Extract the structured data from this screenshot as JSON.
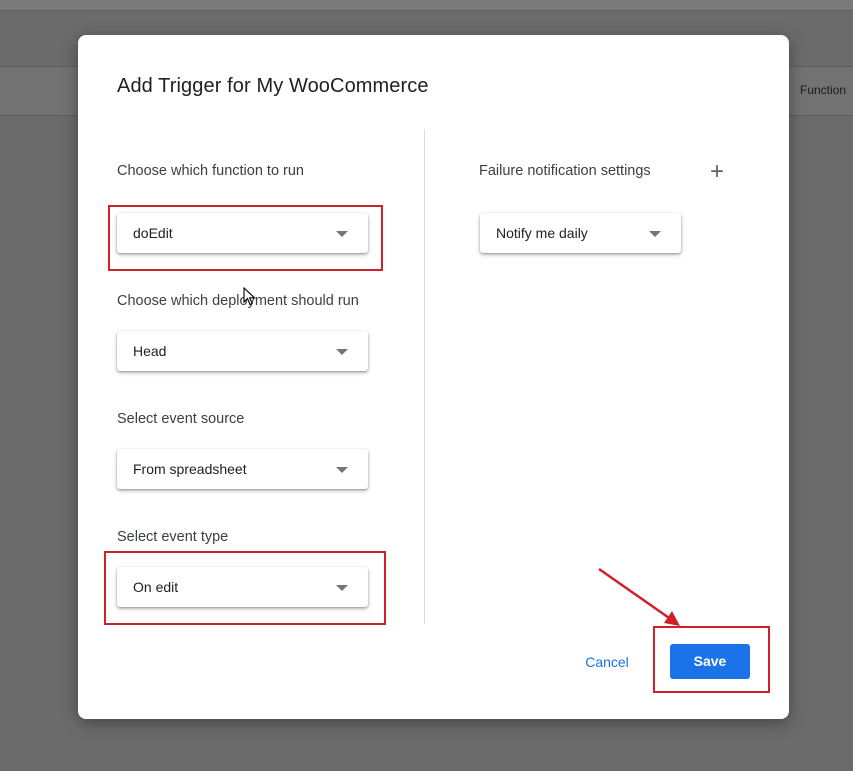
{
  "background": {
    "column_header": "Function"
  },
  "dialog": {
    "title": "Add Trigger for My WooCommerce",
    "left_column": {
      "function": {
        "label": "Choose which function to run",
        "value": "doEdit"
      },
      "deployment": {
        "label": "Choose which deployment should run",
        "value": "Head"
      },
      "event_source": {
        "label": "Select event source",
        "value": "From spreadsheet"
      },
      "event_type": {
        "label": "Select event type",
        "value": "On edit"
      }
    },
    "right_column": {
      "failure_notification": {
        "label": "Failure notification settings",
        "value": "Notify me daily",
        "add_icon": "plus-icon"
      }
    },
    "actions": {
      "cancel_label": "Cancel",
      "save_label": "Save"
    }
  },
  "colors": {
    "accent": "#1a73e8",
    "annotation": "#d0202a",
    "overlay": "#6b6b6b"
  }
}
